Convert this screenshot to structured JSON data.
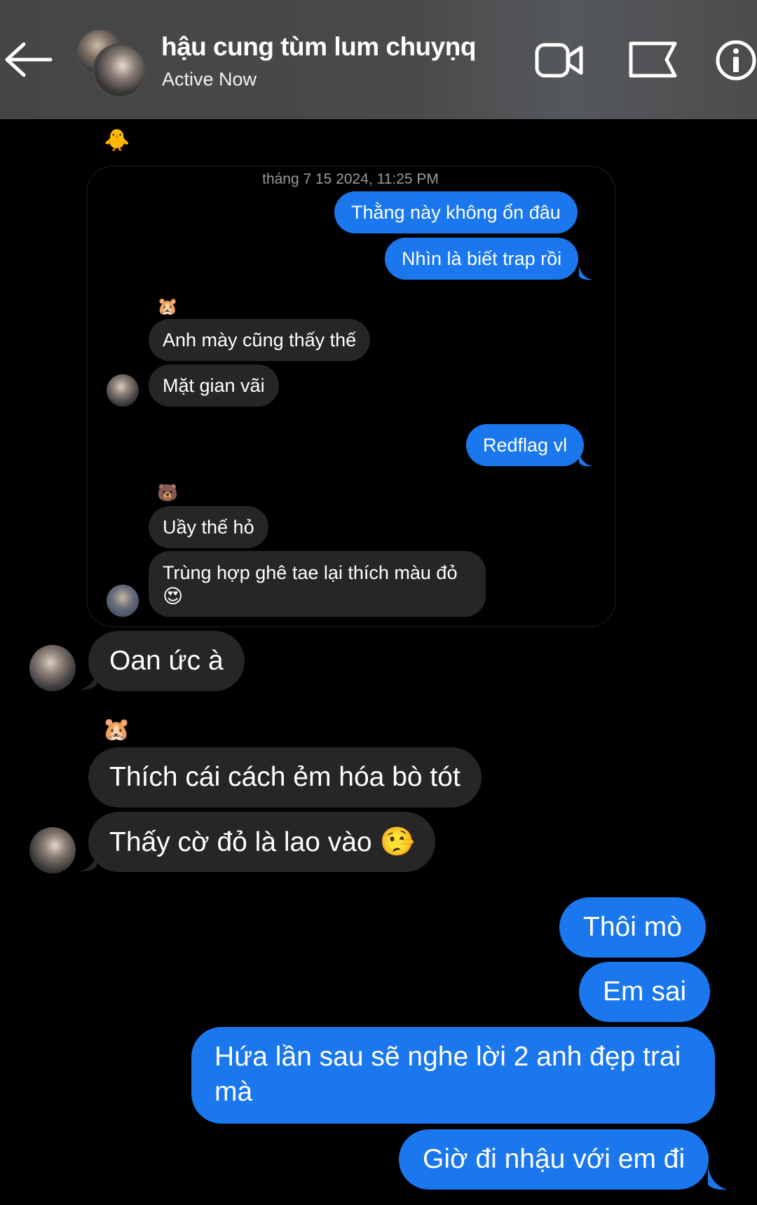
{
  "header": {
    "title": "hậu cung tùm lum chuyṇq",
    "status": "Active Now",
    "icons": [
      "back-arrow-icon",
      "video-call-icon",
      "flag-icon",
      "info-icon"
    ]
  },
  "reply_thread": {
    "sender_tag": "🐥",
    "timestamp": "tháng 7 15 2024, 11:25 PM",
    "messages": {
      "m1": "Thằng này không ổn đâu",
      "m2": "Nhìn là biết trap rồi",
      "m3_tag": "🐹",
      "m3": "Anh mày cũng thấy thế",
      "m4": "Mặt gian vãi",
      "m5": "Redflag vl",
      "m6_tag": "🐻",
      "m6": "Uầy thế hỏ",
      "m7_line1": "Trùng hợp ghê tae lại thích màu đỏ",
      "m7_emoji": "😍"
    }
  },
  "chat": {
    "c1": "Oan ức à",
    "c2_tag": "🐹",
    "c2": "Thích cái cách ẻm hóa bò tót",
    "c3": "Thấy cờ đỏ là lao vào",
    "c3_emoji": "🤥",
    "c4": "Thôi mò",
    "c5": "Em sai",
    "c6_line1": "Hứa lần sau sẽ nghe lời 2 anh đẹp trai",
    "c6_line2": "mà",
    "c7": "Giờ đi nhậu với em đi"
  },
  "colors": {
    "outgoing": "#1a77ee",
    "incoming": "#262626",
    "header": "#4a4a4a"
  }
}
